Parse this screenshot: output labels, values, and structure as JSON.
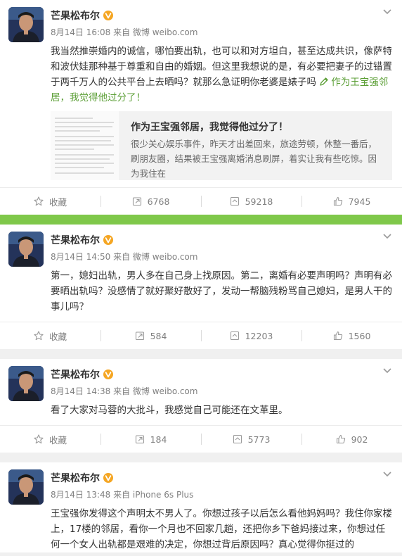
{
  "colors": {
    "separator_green": "#7fc84a",
    "link_orange": "#eb7350",
    "link_green": "#5a9e34"
  },
  "posts": [
    {
      "author": "芒果松布尔",
      "meta": "8月14日 16:08 来自 微博 weibo.com",
      "text": "我当然推崇婚内的诚信，哪怕要出轨，也可以和对方坦白，甚至达成共识，像萨特和波伏娃那种基于尊重和自由的婚姻。但这里我想说的是，有必要把妻子的过错置于两千万人的公共平台上去晒吗？就那么急证明你老婆是婊子吗 ",
      "link_text": "作为王宝强邻居，我觉得他过分了！",
      "link_icon": "pen-icon",
      "article": {
        "title": "作为王宝强邻居，我觉得他过分了！",
        "desc": "很少关心娱乐事件，昨天才出差回来，旅途劳顿，休整一番后，刷朋友圈，结果被王宝强离婚消息刷屏，着实让我有些吃惊。因为我住在"
      },
      "actions": {
        "favorite": "收藏",
        "repost": "6768",
        "comment": "59218",
        "like": "7945"
      }
    },
    {
      "author": "芒果松布尔",
      "meta": "8月14日 14:50 来自 微博 weibo.com",
      "text": "第一，媳妇出轨，男人多在自己身上找原因。第二，离婚有必要声明吗？声明有必要晒出轨吗？没感情了就好聚好散好了，发动一帮脑残粉骂自己媳妇，是男人干的事儿吗？",
      "actions": {
        "favorite": "收藏",
        "repost": "584",
        "comment": "12203",
        "like": "1560"
      }
    },
    {
      "author": "芒果松布尔",
      "meta": "8月14日 14:38 来自 微博 weibo.com",
      "text": "看了大家对马蓉的大批斗，我感觉自己可能还在文革里。",
      "actions": {
        "favorite": "收藏",
        "repost": "184",
        "comment": "5773",
        "like": "902"
      }
    },
    {
      "author": "芒果松布尔",
      "meta": "8月14日 13:48 来自 iPhone 6s Plus",
      "text": "王宝强你发得这个声明太不男人了。你想过孩子以后怎么看他妈妈吗？我住你家楼上，17楼的邻居，看你一个月也不回家几趟，还把你乡下爸妈接过来，你想过任何一个女人出轨都是艰难的决定，你想过背后原因吗？真心觉得你挺过的"
    }
  ]
}
